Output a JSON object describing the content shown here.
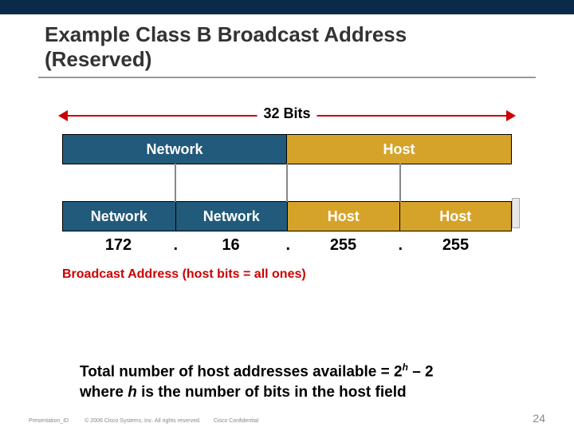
{
  "title_line1": "Example Class B Broadcast Address",
  "title_line2": "(Reserved)",
  "bits_label": "32 Bits",
  "bar1": {
    "network": "Network",
    "host": "Host"
  },
  "bar2": {
    "c1": "Network",
    "c2": "Network",
    "c3": "Host",
    "c4": "Host"
  },
  "values": {
    "v1": "172",
    "v2": "16",
    "v3": "255",
    "v4": "255",
    "dot": "."
  },
  "broadcast": "Broadcast Address (host bits = all ones)",
  "formula_line1a": "Total number of host addresses available = 2",
  "formula_h_sup": "h",
  "formula_line1b": " – 2",
  "formula_line2a": "where ",
  "formula_h_italic": "h",
  "formula_line2b": " is the number of bits in the host field",
  "footer": {
    "pid": "Presentation_ID",
    "copy": "© 2006 Cisco Systems, Inc. All rights reserved.",
    "conf": "Cisco Confidential",
    "pageno": "24"
  }
}
